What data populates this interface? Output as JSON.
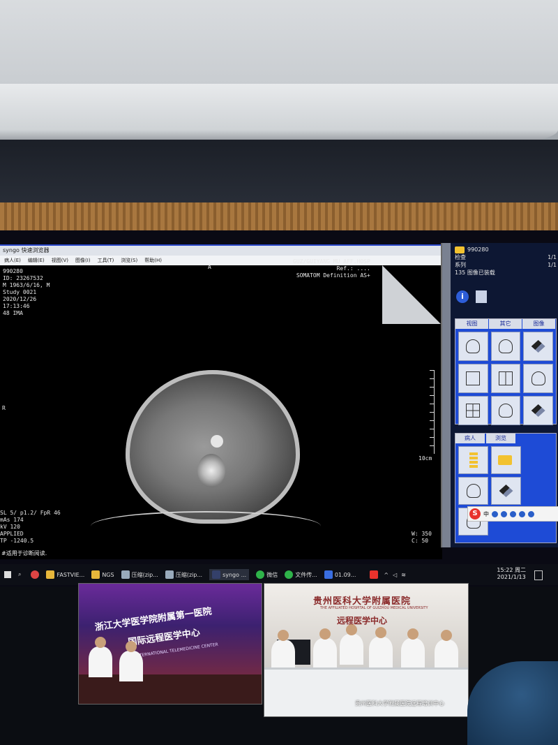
{
  "app": {
    "title": "syngo 快速浏览器",
    "menu": [
      "病人(E)",
      "编辑(E)",
      "视图(V)",
      "图像(I)",
      "工具(T)",
      "浏览(S)",
      "帮助(H)"
    ]
  },
  "overlay": {
    "top_left": "990280\nID: 23267532\nM 1963/6/16, M\nStudy 0021\n2020/12/26\n17:13:46\n48 IMA",
    "top_right": "GUZ/GUIYANG MU AFF.HOSP\nRef.: ....\nSOMATOM Definition AS+",
    "orient_top": "A",
    "orient_left": "R",
    "bottom_left": "SL 5/ p1.2/ FpR 46\nmAs 174\nkV 120\nAPPLIED\nTP -1240.5",
    "scale_label": "10cm",
    "bottom_right": "W: 350\nC: 50"
  },
  "side": {
    "patient_id": "990280",
    "rows": [
      {
        "label": "检查",
        "value": "1/1"
      },
      {
        "label": "系列",
        "value": "1/1"
      }
    ],
    "loaded": "135 图像已装载",
    "tabs1": [
      "视图",
      "其它",
      "图像"
    ],
    "tabs2": [
      "病人",
      "浏览"
    ]
  },
  "ime": {
    "logo": "S",
    "mode": "中"
  },
  "status_line": "#适用于诊断阅读.",
  "taskbar": {
    "items": [
      "FASTVIE...",
      "NGS",
      "压缩(zip...",
      "压缩(zip...",
      "syngo ...",
      "微信",
      "文件传...",
      "01.09..."
    ],
    "time": "15:22 周二",
    "date": "2021/1/13"
  },
  "video_left": {
    "title": "浙江大学医学院附属第一医院",
    "subtitle": "国际远程医学中心",
    "english": "INTERNATIONAL TELEMEDICINE CENTER"
  },
  "video_right": {
    "title": "贵州医科大学附属医院",
    "english": "THE AFFILIATED HOSPITAL OF GUIZHOU MEDICAL UNIVERSITY",
    "subtitle": "远程医学中心",
    "caption": "贵州医科大学附属医院远程培训中心"
  }
}
